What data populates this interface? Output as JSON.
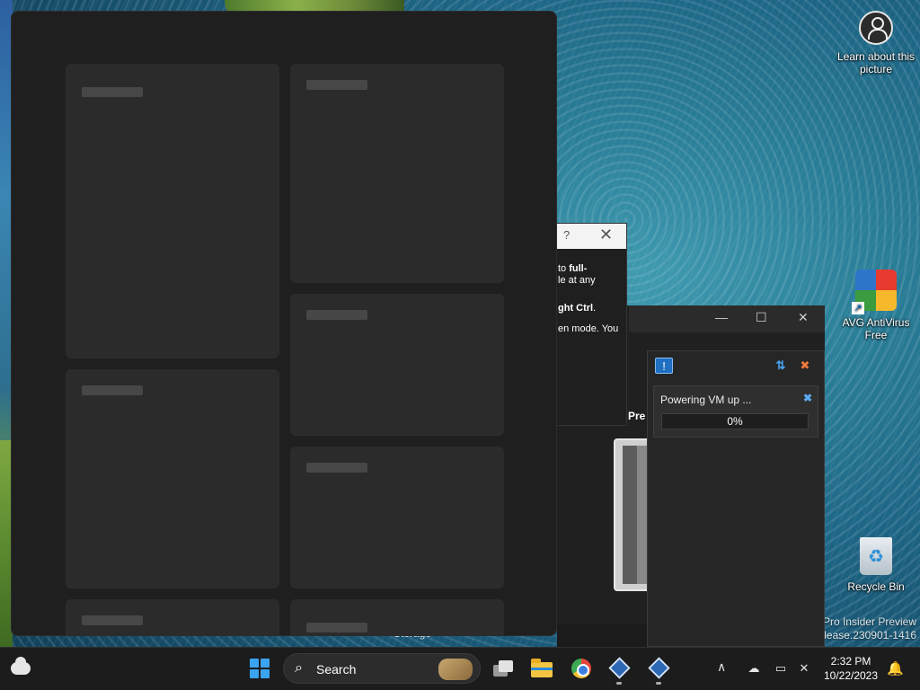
{
  "desktop": {
    "icons": [
      {
        "label": "Learn about this picture"
      },
      {
        "label": "AVG AntiVirus Free"
      },
      {
        "label": "Recycle Bin"
      }
    ],
    "watermark": {
      "line1": "Pro Insider Preview",
      "line2": "elease.230901-1416"
    }
  },
  "dialog": {
    "help_glyph": "?",
    "close_glyph": "✕",
    "line1_pre": "to ",
    "line1_bold": "full-",
    "line2": "le at any",
    "line3_bold": "ght Ctrl",
    "line3_post": ".",
    "line4": "en mode. You"
  },
  "vbox_manager": {
    "minimize_glyph": "—",
    "maximize_glyph": "☐",
    "close_glyph": "✕",
    "preview_label": "Pre",
    "storage_label": "Storage"
  },
  "progress": {
    "message": "Powering VM up ...",
    "percent_text": "0%",
    "progress_fraction": 0.0
  },
  "taskbar": {
    "search_placeholder": "Search",
    "clock_time": "2:32 PM",
    "clock_date": "10/22/2023",
    "chevron": "∧"
  },
  "colors": {
    "accent": "#2f7fd0",
    "window_bg": "#1f1f1f",
    "tile_bg": "#2b2b2b",
    "taskbar_bg": "#1c1c1c"
  }
}
